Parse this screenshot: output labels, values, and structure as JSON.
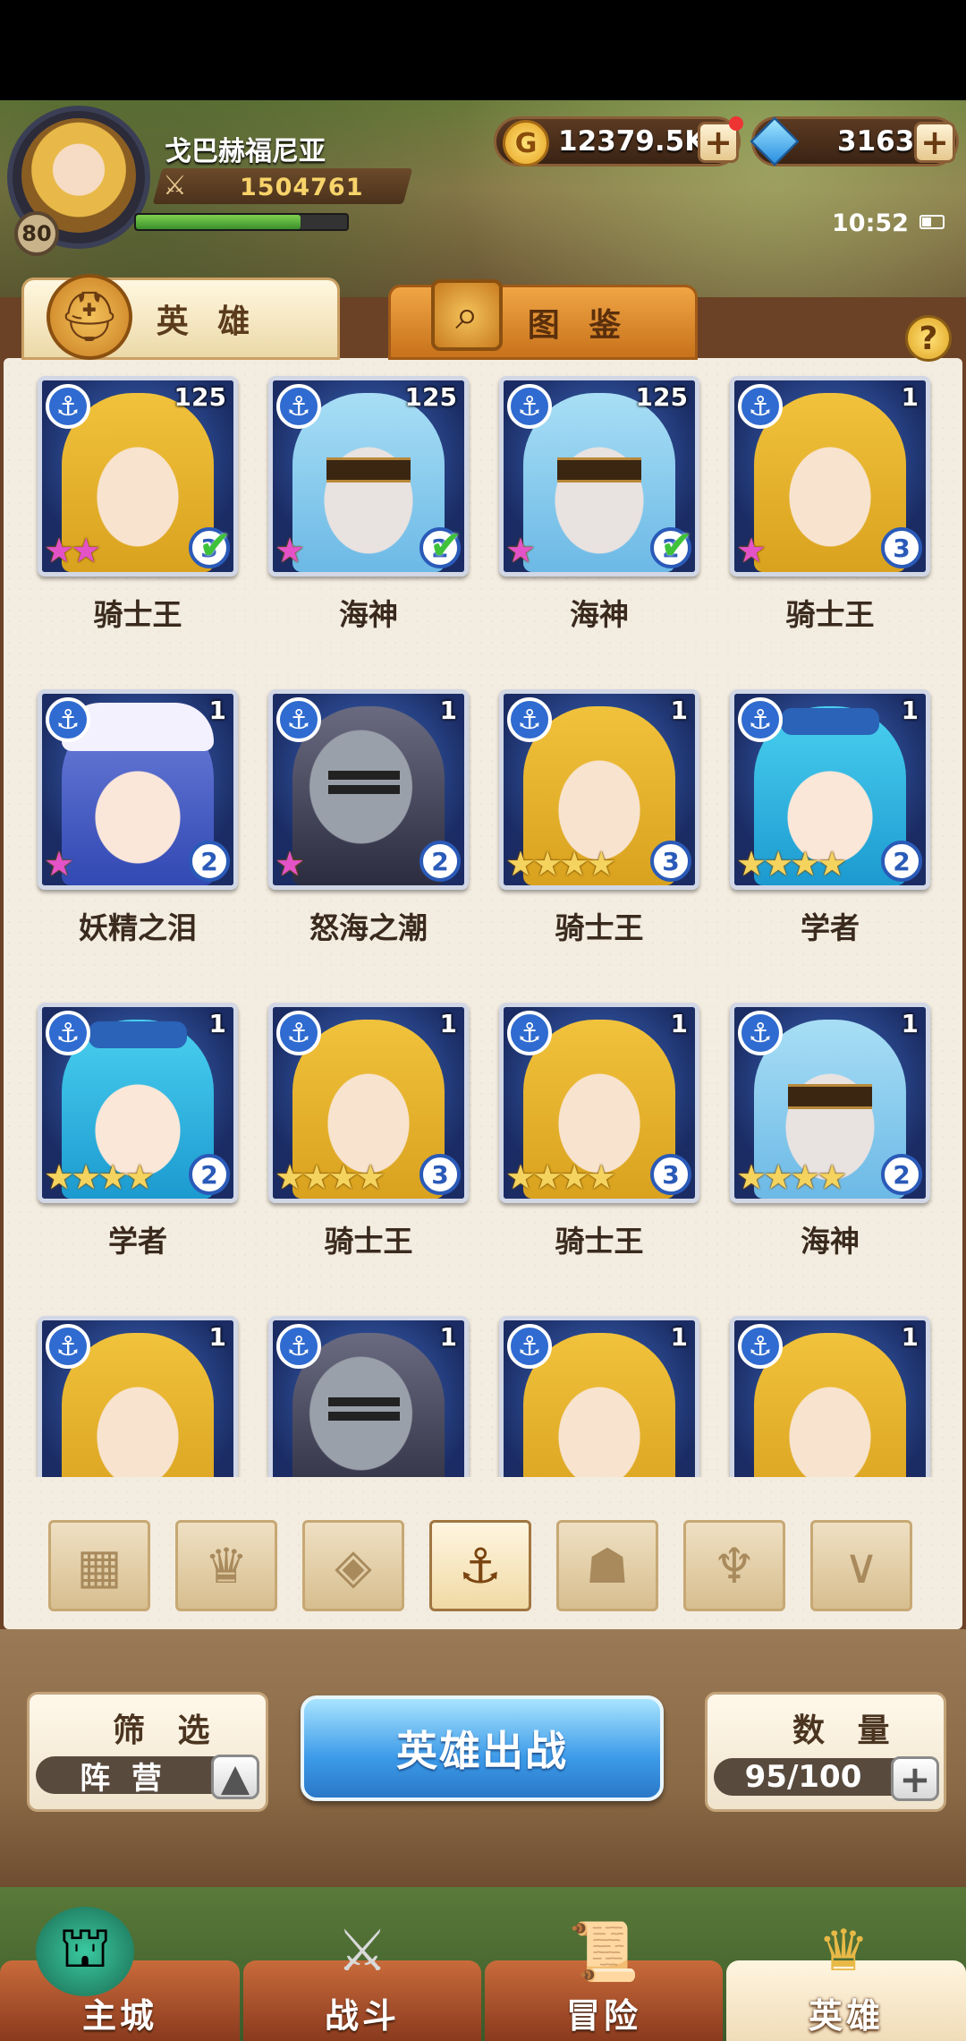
{
  "player": {
    "name": "戈巴赫福尼亚",
    "level": "80",
    "power": "1504761",
    "xp_fraction": 0.78
  },
  "resources": {
    "gold": "12379.5K",
    "gems": "3163",
    "plus": "+"
  },
  "status": {
    "time": "10:52"
  },
  "tabs": [
    {
      "label": "英 雄"
    },
    {
      "label": "图 鉴"
    }
  ],
  "help": "?",
  "heroes": [
    {
      "name": "骑士王",
      "count": "125",
      "stars": "★★",
      "rainbow": true,
      "grade": "3",
      "checked": true,
      "type": "knight"
    },
    {
      "name": "海神",
      "count": "125",
      "stars": "★",
      "rainbow": true,
      "grade": "2",
      "checked": true,
      "type": "sea"
    },
    {
      "name": "海神",
      "count": "125",
      "stars": "★",
      "rainbow": true,
      "grade": "2",
      "checked": true,
      "type": "sea"
    },
    {
      "name": "骑士王",
      "count": "1",
      "stars": "★",
      "rainbow": true,
      "grade": "3",
      "checked": false,
      "type": "knight"
    },
    {
      "name": "妖精之泪",
      "count": "1",
      "stars": "★",
      "rainbow": true,
      "grade": "2",
      "checked": false,
      "type": "fairy"
    },
    {
      "name": "怒海之潮",
      "count": "1",
      "stars": "★",
      "rainbow": true,
      "grade": "2",
      "checked": false,
      "type": "armor"
    },
    {
      "name": "骑士王",
      "count": "1",
      "stars": "★★★★",
      "rainbow": false,
      "grade": "3",
      "checked": false,
      "type": "knight"
    },
    {
      "name": "学者",
      "count": "1",
      "stars": "★★★★",
      "rainbow": false,
      "grade": "2",
      "checked": false,
      "type": "scholar"
    },
    {
      "name": "学者",
      "count": "1",
      "stars": "★★★★",
      "rainbow": false,
      "grade": "2",
      "checked": false,
      "type": "scholar"
    },
    {
      "name": "骑士王",
      "count": "1",
      "stars": "★★★★",
      "rainbow": false,
      "grade": "3",
      "checked": false,
      "type": "knight"
    },
    {
      "name": "骑士王",
      "count": "1",
      "stars": "★★★★",
      "rainbow": false,
      "grade": "3",
      "checked": false,
      "type": "knight"
    },
    {
      "name": "海神",
      "count": "1",
      "stars": "★★★★",
      "rainbow": false,
      "grade": "2",
      "checked": false,
      "type": "sea"
    },
    {
      "name": "",
      "count": "1",
      "stars": "",
      "rainbow": false,
      "grade": "",
      "checked": false,
      "type": "knight"
    },
    {
      "name": "",
      "count": "1",
      "stars": "",
      "rainbow": false,
      "grade": "",
      "checked": false,
      "type": "armor"
    },
    {
      "name": "",
      "count": "1",
      "stars": "",
      "rainbow": false,
      "grade": "",
      "checked": false,
      "type": "knight"
    },
    {
      "name": "",
      "count": "1",
      "stars": "",
      "rainbow": false,
      "grade": "",
      "checked": false,
      "type": "knight"
    }
  ],
  "filter_icons": [
    {
      "name": "all-filter-icon",
      "glyph": "▦",
      "active": false
    },
    {
      "name": "faction-flame-icon",
      "glyph": "♛",
      "active": false
    },
    {
      "name": "faction-diamond-icon",
      "glyph": "◈",
      "active": false
    },
    {
      "name": "faction-anchor-icon",
      "glyph": "⚓",
      "active": true
    },
    {
      "name": "faction-beast-icon",
      "glyph": "☗",
      "active": false
    },
    {
      "name": "faction-horn-icon",
      "glyph": "♆",
      "active": false
    },
    {
      "name": "faction-wing-icon",
      "glyph": "∨",
      "active": false
    }
  ],
  "controls": {
    "filter_label": "筛 选",
    "filter_value": "阵 营",
    "deploy_label": "英雄出战",
    "quantity_label": "数 量",
    "quantity_value": "95/100"
  },
  "nav": [
    {
      "label": "主城"
    },
    {
      "label": "战斗"
    },
    {
      "label": "冒险"
    },
    {
      "label": "英雄"
    }
  ]
}
